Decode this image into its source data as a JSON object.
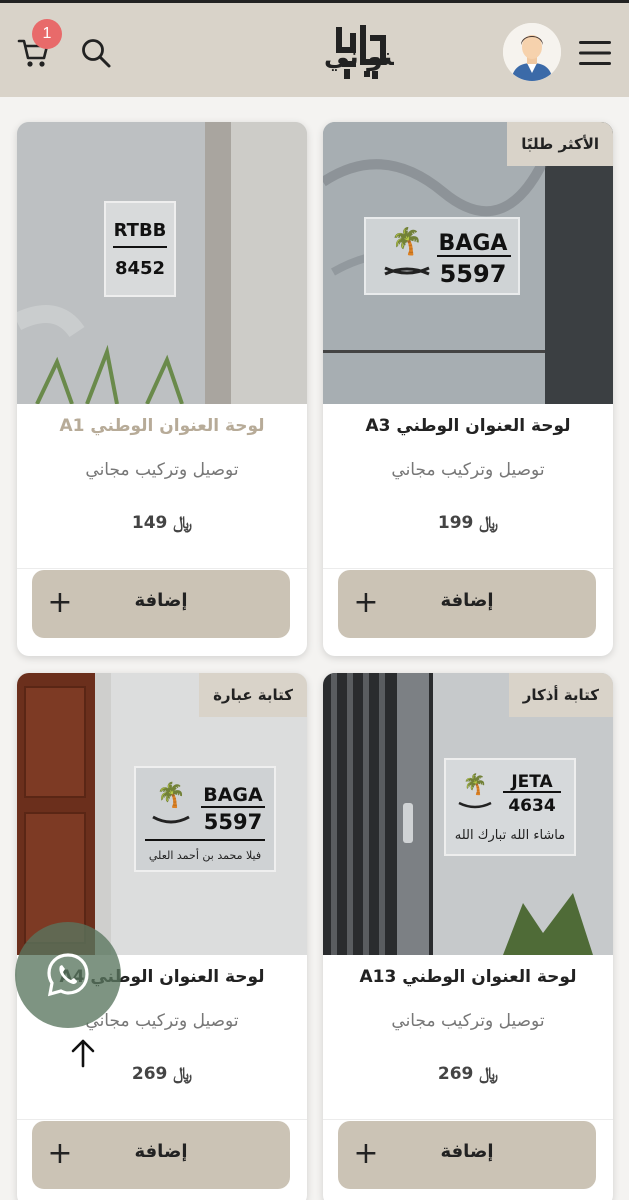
{
  "header": {
    "cart_count": "1",
    "logo_text": "عنواني",
    "icons": [
      "cart-icon",
      "search-icon",
      "user-avatar",
      "hamburger-menu-icon"
    ]
  },
  "products": [
    {
      "name": "لوحة العنوان الوطني A3",
      "subtitle": "توصيل وتركيب مجاني",
      "price": "199",
      "currency": "﷼",
      "badge": "الأكثر طلبًا",
      "add_label": "إضافة",
      "plate": {
        "code": "BAGA",
        "number": "5597"
      }
    },
    {
      "name": "لوحة العنوان الوطني A1",
      "subtitle": "توصيل وتركيب مجاني",
      "price": "149",
      "currency": "﷼",
      "badge": "",
      "add_label": "إضافة",
      "plate": {
        "code": "RTBB",
        "number": "8452"
      }
    },
    {
      "name": "لوحة العنوان الوطني A13",
      "subtitle": "توصيل وتركيب مجاني",
      "price": "269",
      "currency": "﷼",
      "badge": "كتابة أذكار",
      "add_label": "إضافة",
      "plate": {
        "code": "JETA",
        "number": "4634",
        "inscription": "ماشاء الله تبارك الله"
      }
    },
    {
      "name": "لوحة العنوان الوطني A4",
      "subtitle": "توصيل وتركيب مجاني",
      "price": "269",
      "currency": "﷼",
      "badge": "كتابة عبارة",
      "add_label": "إضافة",
      "plate": {
        "code": "BAGA",
        "number": "5597",
        "inscription": "فيلا محمد بن أحمد العلي"
      }
    }
  ],
  "colors": {
    "header_bg": "#d9d3c9",
    "button_bg": "#cbc3b5",
    "badge_red": "#e86a6a",
    "whatsapp_green": "#5a765f"
  }
}
